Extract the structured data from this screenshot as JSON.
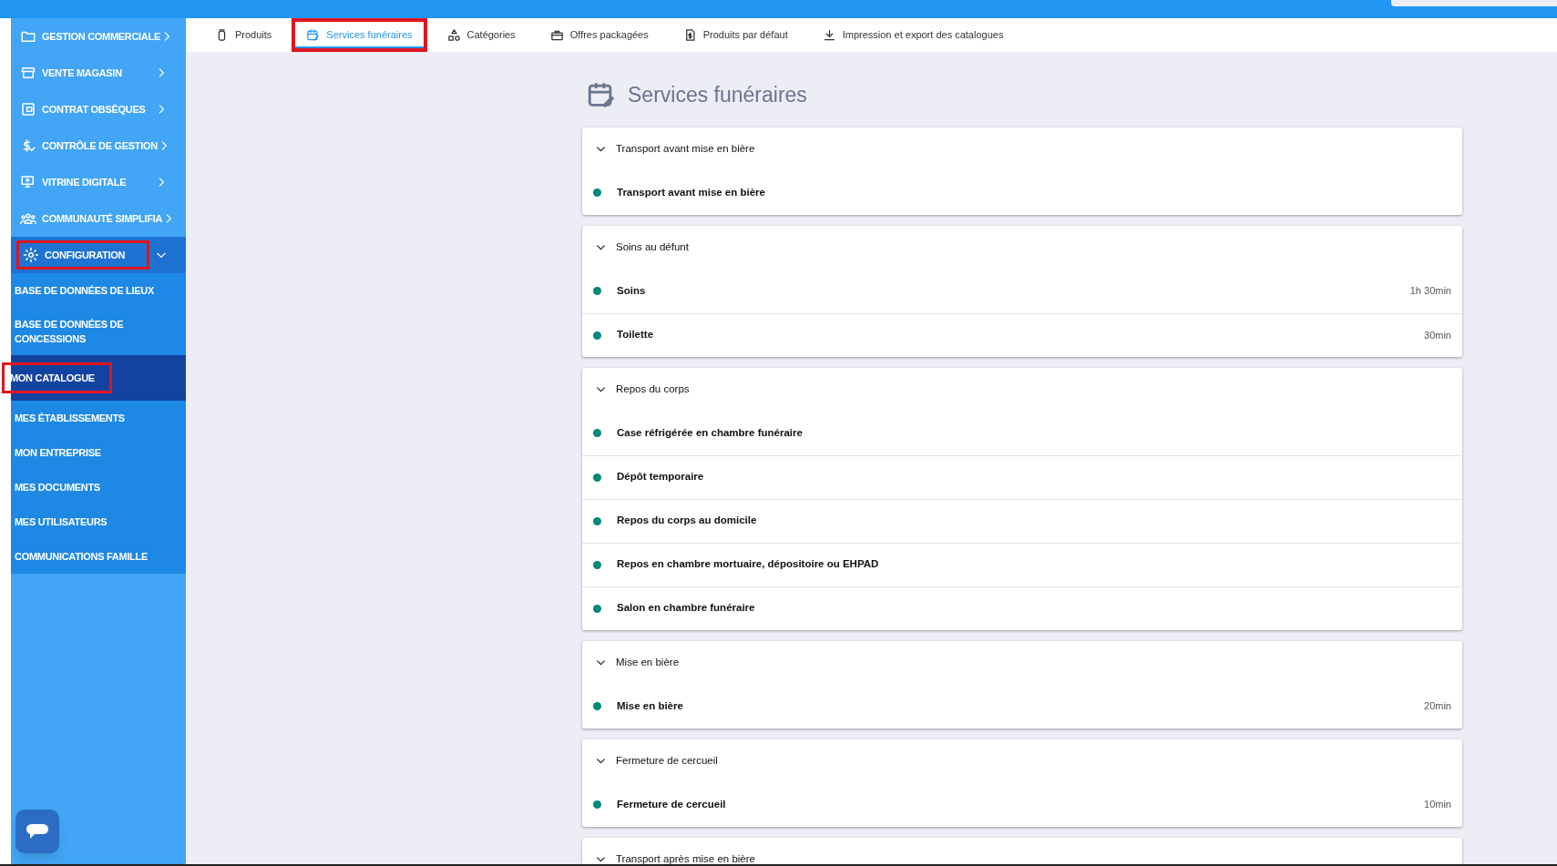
{
  "sidebar": {
    "items": [
      {
        "label": "GESTION COMMERCIALE",
        "expanded": false,
        "highlighted": false
      },
      {
        "label": "VENTE MAGASIN",
        "expanded": false,
        "highlighted": false
      },
      {
        "label": "CONTRAT OBSÈQUES",
        "expanded": false,
        "highlighted": false
      },
      {
        "label": "CONTRÔLE DE GESTION",
        "expanded": false,
        "highlighted": false
      },
      {
        "label": "VITRINE DIGITALE",
        "expanded": false,
        "highlighted": false
      },
      {
        "label": "COMMUNAUTÉ SIMPLIFIA",
        "expanded": false,
        "highlighted": false
      },
      {
        "label": "CONFIGURATION",
        "expanded": true,
        "highlighted": true,
        "children": [
          {
            "label": "BASE DE DONNÉES DE LIEUX",
            "selected": false,
            "highlighted": false
          },
          {
            "label": "BASE DE DONNÉES DE CONCESSIONS",
            "selected": false,
            "highlighted": false
          },
          {
            "label": "MON CATALOGUE",
            "selected": true,
            "highlighted": true
          },
          {
            "label": "MES ÉTABLISSEMENTS",
            "selected": false,
            "highlighted": false
          },
          {
            "label": "MON ENTREPRISE",
            "selected": false,
            "highlighted": false
          },
          {
            "label": "MES DOCUMENTS",
            "selected": false,
            "highlighted": false
          },
          {
            "label": "MES UTILISATEURS",
            "selected": false,
            "highlighted": false
          },
          {
            "label": "COMMUNICATIONS FAMILLE",
            "selected": false,
            "highlighted": false
          }
        ]
      }
    ]
  },
  "tabs": [
    {
      "label": "Produits",
      "selected": false,
      "highlighted": false
    },
    {
      "label": "Services funéraires",
      "selected": true,
      "highlighted": true
    },
    {
      "label": "Catégories",
      "selected": false,
      "highlighted": false
    },
    {
      "label": "Offres packagées",
      "selected": false,
      "highlighted": false
    },
    {
      "label": "Produits par défaut",
      "selected": false,
      "highlighted": false
    },
    {
      "label": "Impression et export des catalogues",
      "selected": false,
      "highlighted": false
    }
  ],
  "page_title": "Services funéraires",
  "groups": [
    {
      "title": "Transport avant mise en bière",
      "expanded": true,
      "items": [
        {
          "name": "Transport avant mise en bière",
          "color": "#00897b"
        }
      ]
    },
    {
      "title": "Soins au défunt",
      "expanded": true,
      "items": [
        {
          "name": "Soins",
          "duration": "1h 30min",
          "color": "#00897b"
        },
        {
          "name": "Toilette",
          "duration": "30min",
          "color": "#00897b"
        }
      ]
    },
    {
      "title": "Repos du corps",
      "expanded": true,
      "items": [
        {
          "name": "Case réfrigérée en chambre funéraire",
          "color": "#00897b"
        },
        {
          "name": "Dépôt temporaire",
          "color": "#00897b"
        },
        {
          "name": "Repos du corps au domicile",
          "color": "#00897b"
        },
        {
          "name": "Repos en chambre mortuaire, dépositoire ou EHPAD",
          "color": "#00897b"
        },
        {
          "name": "Salon en chambre funéraire",
          "color": "#00897b"
        }
      ]
    },
    {
      "title": "Mise en bière",
      "expanded": true,
      "items": [
        {
          "name": "Mise en bière",
          "duration": "20min",
          "color": "#00897b"
        }
      ]
    },
    {
      "title": "Fermeture de cercueil",
      "expanded": true,
      "items": [
        {
          "name": "Fermeture de cercueil",
          "duration": "10min",
          "color": "#00897b"
        }
      ]
    },
    {
      "title": "Transport après mise en bière",
      "expanded": true
    }
  ]
}
